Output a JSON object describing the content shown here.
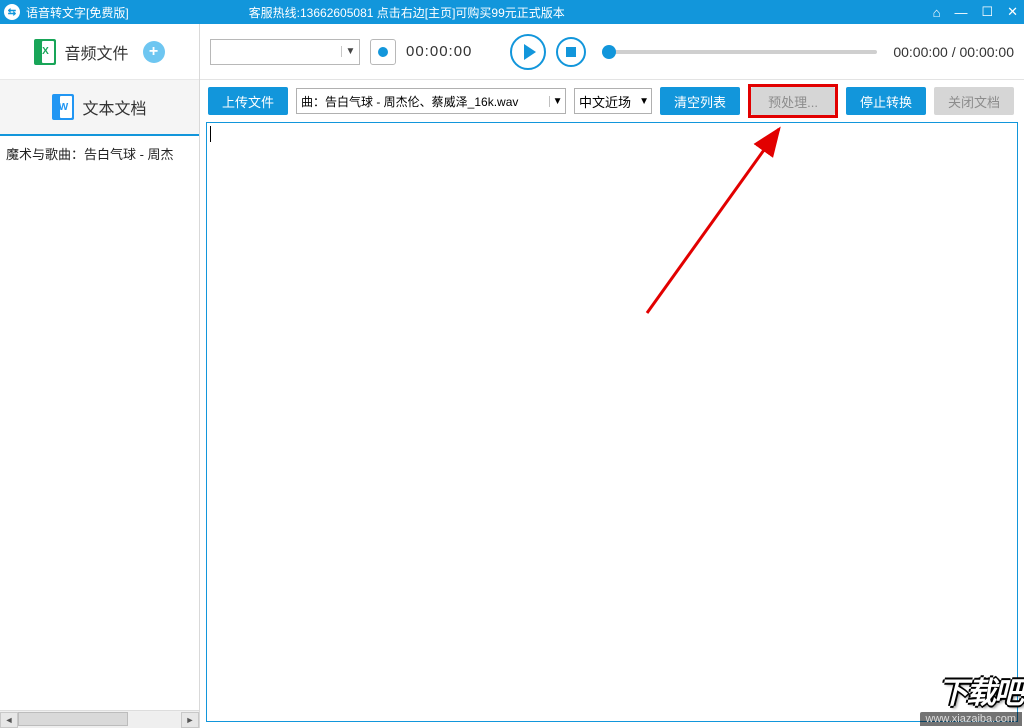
{
  "titlebar": {
    "app_icon_glyph": "⇆",
    "title": "语音转文字[免费版]",
    "hotline": "客服热线:13662605081  点击右边[主页]可购买99元正式版本"
  },
  "sidebar": {
    "tab_audio": {
      "label": "音频文件",
      "icon_letter": "X"
    },
    "tab_text": {
      "label": "文本文档",
      "icon_letter": "W"
    },
    "file_list_item": "魔术与歌曲：告白气球 - 周杰"
  },
  "player": {
    "dropdown_value": "",
    "time_current": "00:00:00",
    "time_display": "00:00:00 / 00:00:00"
  },
  "toolbar": {
    "upload_label": "上传文件",
    "file_selected": "曲：告白气球 - 周杰伦、蔡威泽_16k.wav",
    "language_value": "中文近场",
    "clear_label": "清空列表",
    "preprocess_label": "预处理...",
    "stop_label": "停止转换",
    "close_label": "关闭文档"
  },
  "watermark": {
    "logo": "下载吧",
    "url": "www.xiazaiba.com"
  }
}
